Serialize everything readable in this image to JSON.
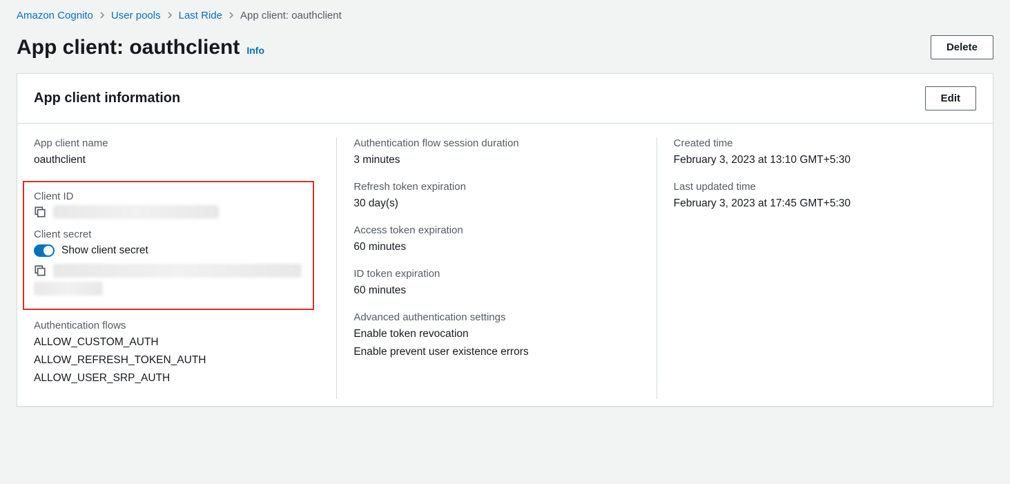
{
  "breadcrumb": {
    "items": [
      {
        "label": "Amazon Cognito"
      },
      {
        "label": "User pools"
      },
      {
        "label": "Last Ride"
      }
    ],
    "current": "App client: oauthclient"
  },
  "header": {
    "title": "App client: oauthclient",
    "info_label": "Info",
    "delete_label": "Delete"
  },
  "panel": {
    "title": "App client information",
    "edit_label": "Edit"
  },
  "col1": {
    "name_label": "App client name",
    "name_value": "oauthclient",
    "client_id_label": "Client ID",
    "client_secret_label": "Client secret",
    "toggle_label": "Show client secret",
    "auth_flows_label": "Authentication flows",
    "auth_flows": [
      "ALLOW_CUSTOM_AUTH",
      "ALLOW_REFRESH_TOKEN_AUTH",
      "ALLOW_USER_SRP_AUTH"
    ]
  },
  "col2": {
    "session_label": "Authentication flow session duration",
    "session_value": "3 minutes",
    "refresh_label": "Refresh token expiration",
    "refresh_value": "30 day(s)",
    "access_label": "Access token expiration",
    "access_value": "60 minutes",
    "id_label": "ID token expiration",
    "id_value": "60 minutes",
    "adv_label": "Advanced authentication settings",
    "adv_values": [
      "Enable token revocation",
      "Enable prevent user existence errors"
    ]
  },
  "col3": {
    "created_label": "Created time",
    "created_value": "February 3, 2023 at 13:10 GMT+5:30",
    "updated_label": "Last updated time",
    "updated_value": "February 3, 2023 at 17:45 GMT+5:30"
  }
}
